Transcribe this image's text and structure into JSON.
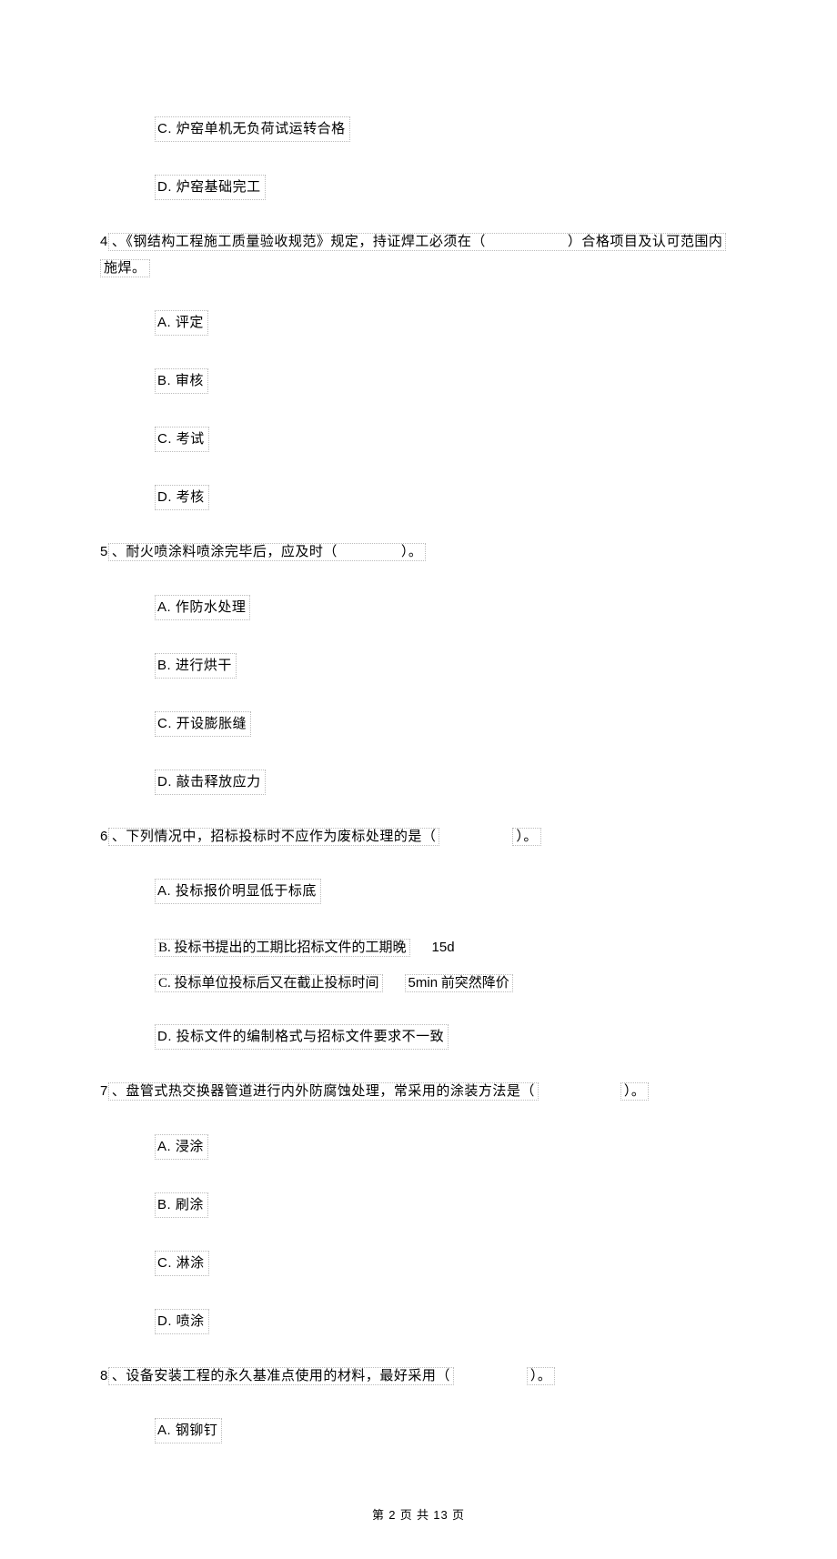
{
  "partial_q3": {
    "option_c": "炉窑单机无负荷试运转合格",
    "option_d": "炉窑基础完工"
  },
  "q4": {
    "num": "4",
    "stem_pre": "、《钢结构工程施工质量验收规范》规定，持证焊工必须在（",
    "stem_post": "）合格项目及认可范围内",
    "stem_line2": "施焊。",
    "a": "评定",
    "b": "审核",
    "c": "考试",
    "d": "考核"
  },
  "q5": {
    "num": "5",
    "stem_pre": "、耐火喷涂料喷涂完毕后，应及时（",
    "stem_post": "）。",
    "a": "作防水处理",
    "b": "进行烘干",
    "c": "开设膨胀缝",
    "d": "敲击释放应力"
  },
  "q6": {
    "num": "6",
    "stem_pre": "、下列情况中，招标投标时不应作为废标处理的是（",
    "stem_post": "）。",
    "a": "投标报价明显低于标底",
    "b_pre": "投标书提出的工期比招标文件的工期晚",
    "b_post": "15d",
    "c_pre": "投标单位投标后又在截止投标时间",
    "c_mid": "5min",
    "c_post": "前突然降价",
    "d": "投标文件的编制格式与招标文件要求不一致"
  },
  "q7": {
    "num": "7",
    "stem_pre": "、盘管式热交换器管道进行内外防腐蚀处理，常采用的涂装方法是（",
    "stem_post": "）。",
    "a": "浸涂",
    "b": "刷涂",
    "c": "淋涂",
    "d": "喷涂"
  },
  "q8": {
    "num": "8",
    "stem_pre": "、设备安装工程的永久基准点使用的材料，最好采用（",
    "stem_post": "）。",
    "a": "钢铆钉"
  },
  "footer": {
    "pre": "第",
    "cur": "2",
    "mid": "页 共",
    "total": "13",
    "post": "页"
  }
}
